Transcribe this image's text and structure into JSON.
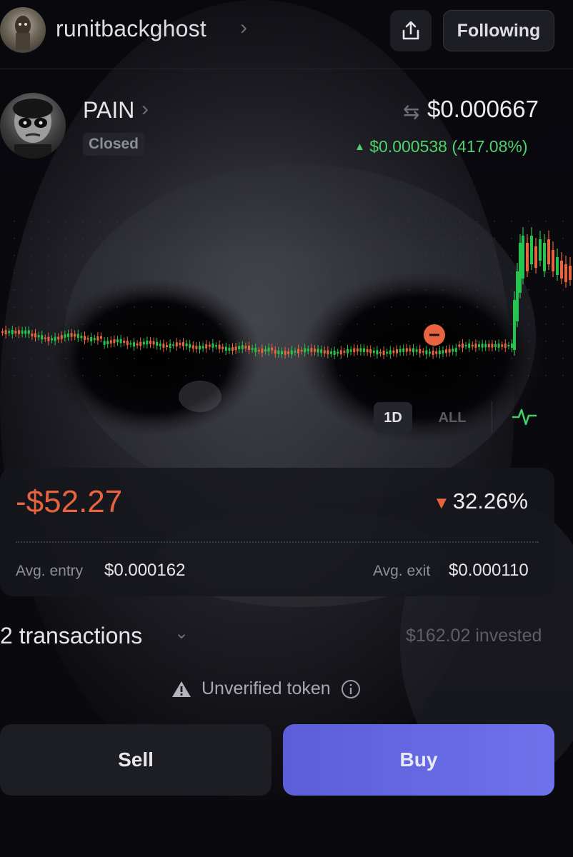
{
  "header": {
    "username": "runitbackghost",
    "follow_label": "Following"
  },
  "token": {
    "name": "PAIN",
    "status": "Closed",
    "price": "$0.000667",
    "change": "$0.000538 (417.08%)",
    "change_color": "#4dd36b"
  },
  "chart": {
    "timeframes": [
      "1D",
      "ALL"
    ],
    "active_timeframe": "1D",
    "up_color": "#27c34f",
    "down_color": "#e8643f"
  },
  "position": {
    "pnl": "-$52.27",
    "pnl_pct": "32.26%",
    "avg_entry_label": "Avg. entry",
    "avg_entry_value": "$0.000162",
    "avg_exit_label": "Avg. exit",
    "avg_exit_value": "$0.000110"
  },
  "transactions": {
    "label": "2 transactions",
    "invested": "$162.02 invested"
  },
  "warning": {
    "text": "Unverified token"
  },
  "actions": {
    "sell_label": "Sell",
    "buy_label": "Buy"
  },
  "icons": [
    "chevron-right-icon",
    "share-icon",
    "swap-icon",
    "trend-up-icon",
    "pulse-icon",
    "triangle-down-icon",
    "chevron-down-icon",
    "warning-icon",
    "info-icon"
  ]
}
